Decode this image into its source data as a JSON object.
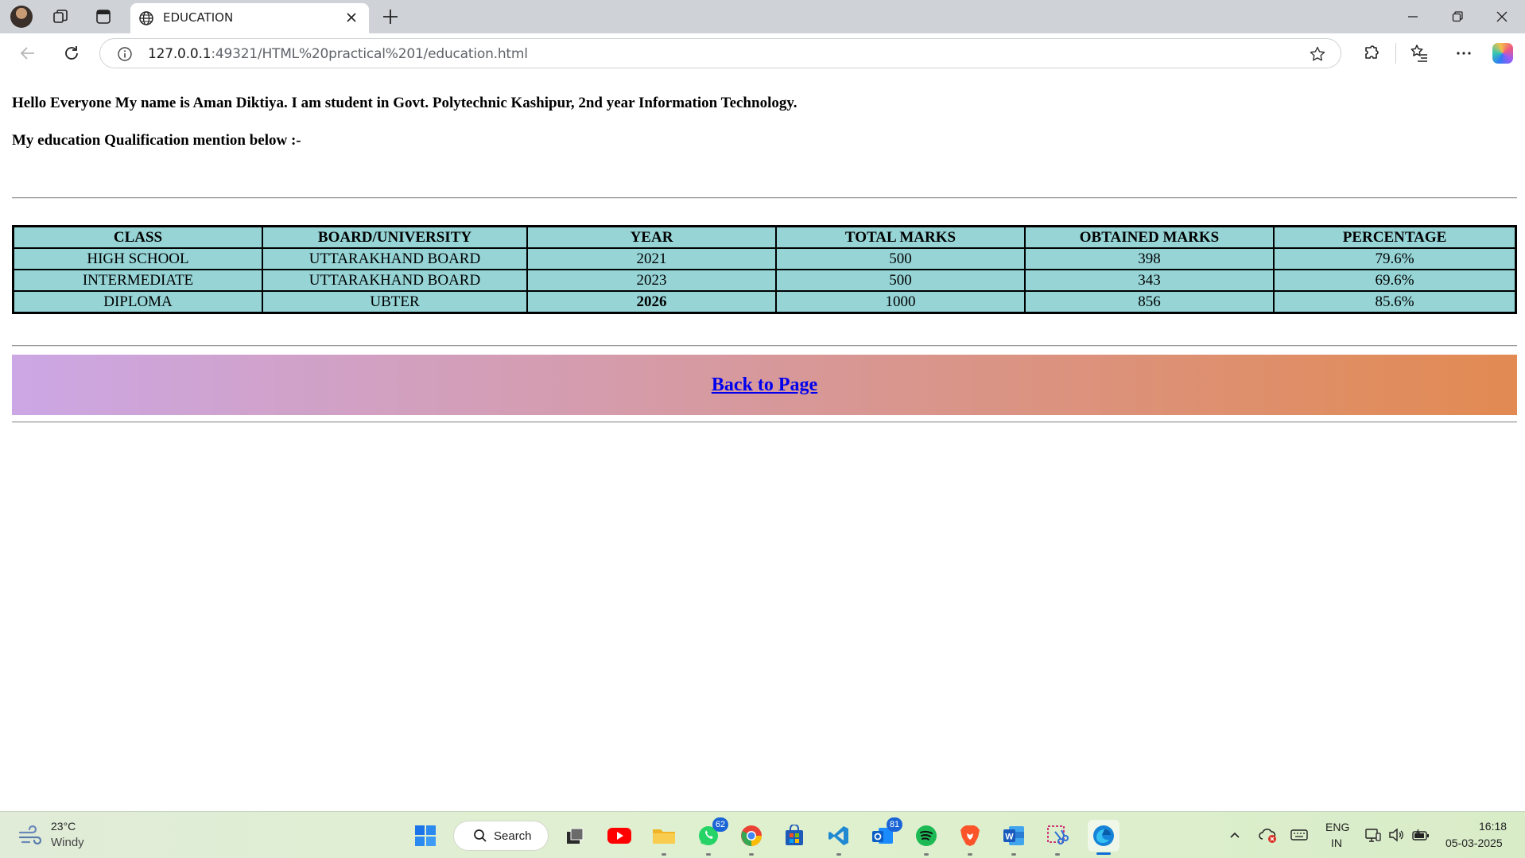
{
  "browser": {
    "tab_title": "EDUCATION",
    "url_host": "127.0.0.1",
    "url_path": ":49321/HTML%20practical%201/education.html"
  },
  "page": {
    "intro": "Hello Everyone My name is Aman Diktiya. I am student in Govt. Polytechnic Kashipur, 2nd year Information Technology.",
    "qualification_heading": "My education Qualification mention below :-",
    "table": {
      "headers": [
        "CLASS",
        "BOARD/UNIVERSITY",
        "YEAR",
        "TOTAL MARKS",
        "OBTAINED MARKS",
        "PERCENTAGE"
      ],
      "rows": [
        [
          "HIGH SCHOOL",
          "UTTARAKHAND BOARD",
          "2021",
          "500",
          "398",
          "79.6%"
        ],
        [
          "INTERMEDIATE",
          "UTTARAKHAND BOARD",
          "2023",
          "500",
          "343",
          "69.6%"
        ],
        [
          "DIPLOMA",
          "UBTER",
          "2026",
          "1000",
          "856",
          "85.6%"
        ]
      ],
      "cell_color": "#96d4d6"
    },
    "back_link": "Back to Page",
    "back_band_colors": [
      "#cca7e5",
      "#e28a52"
    ]
  },
  "taskbar": {
    "weather_temp": "23°C",
    "weather_cond": "Windy",
    "search_label": "Search",
    "whatsapp_badge": "62",
    "outlook_badge": "81",
    "lang_line1": "ENG",
    "lang_line2": "IN",
    "time": "16:18",
    "date": "05-03-2025"
  }
}
